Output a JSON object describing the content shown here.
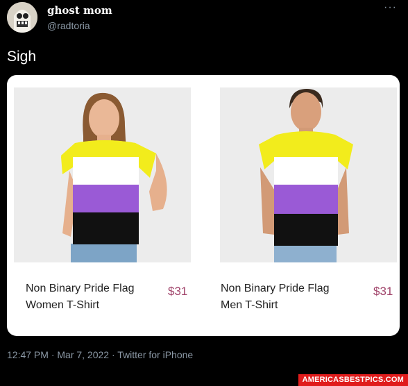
{
  "tweet": {
    "author_name": "ghost mom",
    "author_handle": "@radtoria",
    "more_label": "···",
    "text": "Sigh",
    "timestamp": "12:47 PM · Mar 7, 2022 · Twitter for iPhone"
  },
  "products": [
    {
      "name": "Non Binary Pride Flag Women T-Shirt",
      "price": "$31",
      "image": "woman-model-nonbinary-shirt"
    },
    {
      "name": "Non Binary Pride Flag Men T-Shirt",
      "price": "$31",
      "image": "man-model-nonbinary-shirt"
    }
  ],
  "colors": {
    "yellow": "#f2ec1c",
    "white": "#ffffff",
    "purple": "#9a5ad6",
    "black": "#111111",
    "price": "#a0436a"
  },
  "watermark": "AMERICASBESTPICS.COM"
}
